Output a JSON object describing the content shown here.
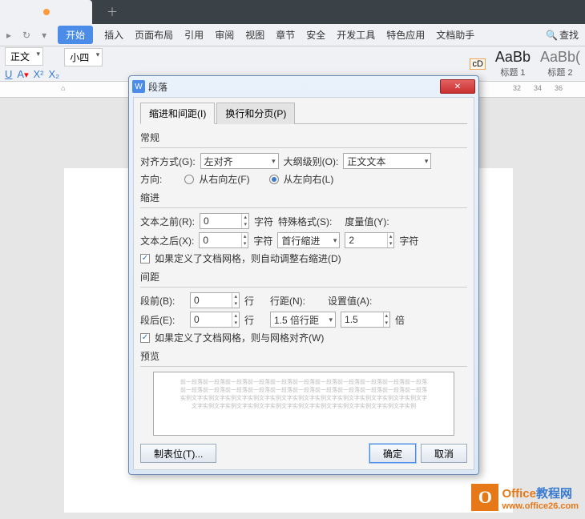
{
  "ribbon": {
    "start": "开始",
    "tabs": [
      "插入",
      "页面布局",
      "引用",
      "审阅",
      "视图",
      "章节",
      "安全",
      "开发工具",
      "特色应用",
      "文档助手"
    ],
    "search": "查找"
  },
  "toolbar": {
    "style_sel": "正文",
    "size_sel": "小四",
    "prefix_cd": "cD",
    "style1_big": "AaBb",
    "style1_lab": "标题 1",
    "style2_big": "AaBb(",
    "style2_lab": "标题 2"
  },
  "ruler_ticks": [
    32,
    34,
    36
  ],
  "dialog": {
    "title": "段落",
    "tabs": {
      "t1": "缩进和间距(I)",
      "t2": "换行和分页(P)"
    },
    "sec_general": "常规",
    "align_label": "对齐方式(G):",
    "align_value": "左对齐",
    "outline_label": "大纲级别(O):",
    "outline_value": "正文文本",
    "direction_label": "方向:",
    "dir_rtl": "从右向左(F)",
    "dir_ltr": "从左向右(L)",
    "sec_indent": "缩进",
    "before_text": "文本之前(R):",
    "after_text": "文本之后(X):",
    "unit_char": "字符",
    "special_label": "特殊格式(S):",
    "special_value": "首行缩进",
    "special_amount_label": "度量值(Y):",
    "special_amount": "2",
    "indent_before": "0",
    "indent_after": "0",
    "indent_chk": "如果定义了文档网格，则自动调整右缩进(D)",
    "sec_spacing": "间距",
    "space_before_label": "段前(B):",
    "space_after_label": "段后(E):",
    "space_before": "0",
    "space_after": "0",
    "unit_line": "行",
    "linespacing_label": "行距(N):",
    "linespacing_value": "1.5 倍行距",
    "setvalue_label": "设置值(A):",
    "setvalue": "1.5",
    "unit_bei": "倍",
    "spacing_chk": "如果定义了文档网格，则与网格对齐(W)",
    "sec_preview": "预览",
    "preview_line1": "前一段落前一段落前一段落前一段落前一段落前一段落前一段落前一段落前一段落前一段落前一段落",
    "preview_line2": "前一段落前一段落前一段落前一段落前一段落前一段落前一段落前一段落前一段落前一段落前一段落",
    "preview_line3": "实例文字实例文字实例文字实例文字实例文字实例文字实例文字实例文字实例文字实例文字实例文字",
    "preview_line4": "文字实例文字实例文字实例文字实例文字实例文字实例文字实例文字实例文字实例文字实例",
    "btn_tabs": "制表位(T)...",
    "btn_ok": "确定",
    "btn_cancel": "取消"
  },
  "watermark": {
    "line1a": "Office",
    "line1b": "教程网",
    "line2": "www.office26.com"
  }
}
